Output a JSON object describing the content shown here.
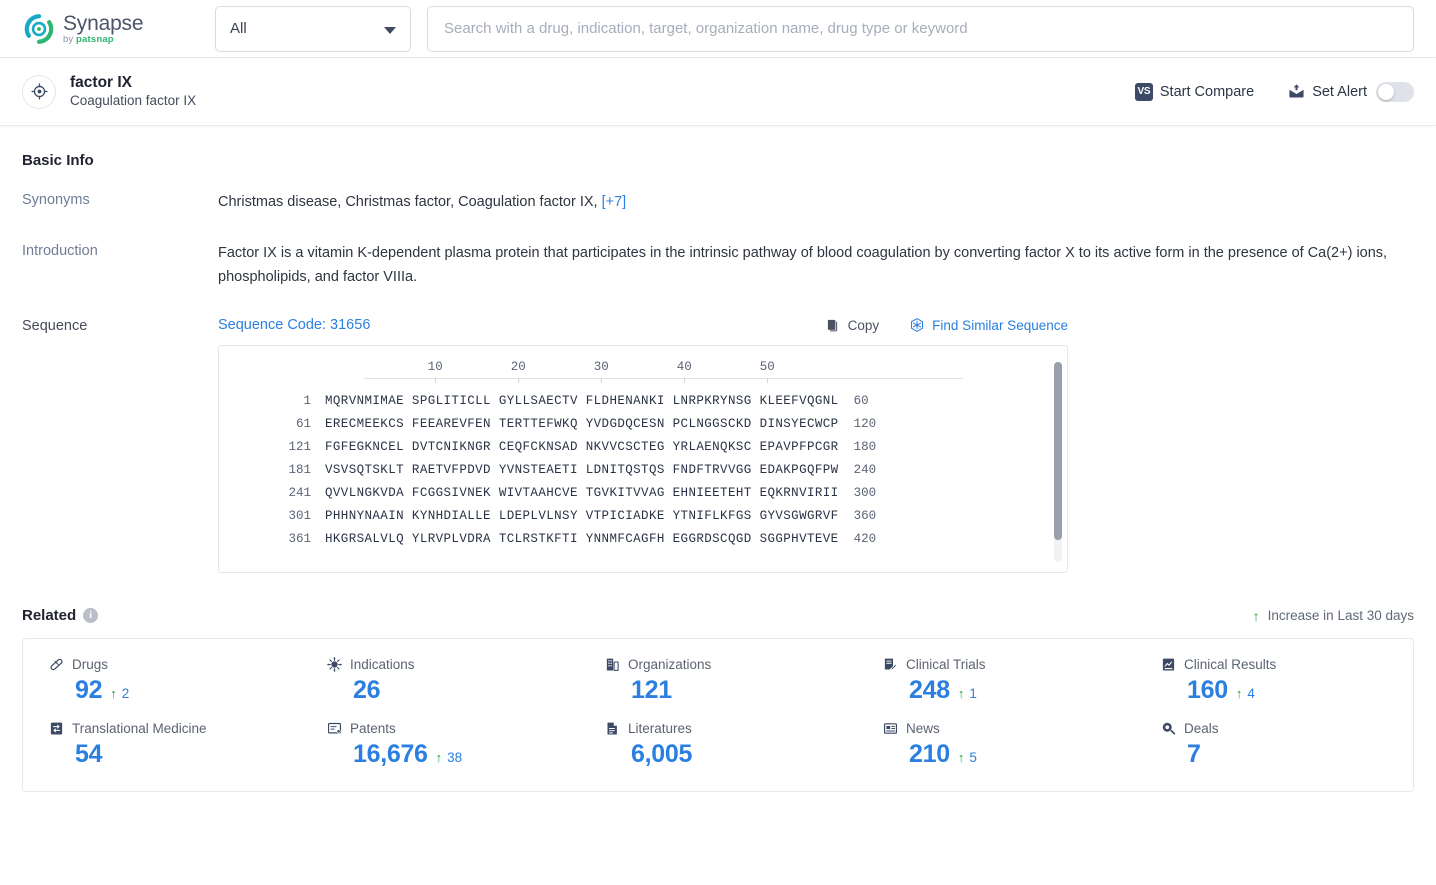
{
  "topbar": {
    "logo_name": "Synapse",
    "logo_sub_prefix": "by ",
    "logo_sub_brand": "patsnap",
    "scope_value": "All",
    "scope_options": [
      "All"
    ],
    "search_placeholder": "Search with a drug, indication, target, organization name, drug type or keyword",
    "search_value": ""
  },
  "entity": {
    "title": "factor IX",
    "subtitle": "Coagulation factor IX",
    "compare_label": "Start Compare",
    "compare_badge": "VS",
    "alert_label": "Set Alert",
    "alert_enabled": false
  },
  "basic_info": {
    "heading": "Basic Info",
    "synonyms_label": "Synonyms",
    "synonyms_value": "Christmas disease,  Christmas factor,  Coagulation factor IX,",
    "synonyms_more": "[+7]",
    "introduction_label": "Introduction",
    "introduction_value": "Factor IX is a vitamin K-dependent plasma protein that participates in the intrinsic pathway of blood coagulation by converting factor X to its active form in the presence of Ca(2+) ions, phospholipids, and factor VIIIa.",
    "sequence_label": "Sequence",
    "sequence_code": "Sequence Code: 31656",
    "copy_label": "Copy",
    "find_similar_label": "Find Similar Sequence"
  },
  "sequence": {
    "ruler_ticks": [
      10,
      20,
      30,
      40,
      50
    ],
    "rows": [
      {
        "start": "1",
        "blocks": "MQRVNMIMAE SPGLITICLL GYLLSAECTV FLDHENANKI LNRPKRYNSG KLEEFVQGNL",
        "end": "60"
      },
      {
        "start": "61",
        "blocks": "ERECMEEKCS FEEAREVFEN TERTTEFWKQ YVDGDQCESN PCLNGGSCKD DINSYECWCP",
        "end": "120"
      },
      {
        "start": "121",
        "blocks": "FGFEGKNCEL DVTCNIKNGR CEQFCKNSAD NKVVCSCTEG YRLAENQKSC EPAVPFPCGR",
        "end": "180"
      },
      {
        "start": "181",
        "blocks": "VSVSQTSKLT RAETVFPDVD YVNSTEAETI LDNITQSTQS FNDFTRVVGG EDAKPGQFPW",
        "end": "240"
      },
      {
        "start": "241",
        "blocks": "QVVLNGKVDA FCGGSIVNEK WIVTAAHCVE TGVKITVVAG EHNIEETEHT EQKRNVIRII",
        "end": "300"
      },
      {
        "start": "301",
        "blocks": "PHHNYNAAIN KYNHDIALLE LDEPLVLNSY VTPICIADKE YTNIFLKFGS GYVSGWGRVF",
        "end": "360"
      },
      {
        "start": "361",
        "blocks": "HKGRSALVLQ YLRVPLVDRA TCLRSTKFTI YNNMFCAGFH EGGRDSCQGD SGGPHVTEVE",
        "end": "420"
      }
    ]
  },
  "related": {
    "heading": "Related",
    "info_glyph": "i",
    "legend_label": "Increase in Last 30 days",
    "legend_arrow": "↑",
    "stats": [
      {
        "label": "Drugs",
        "icon": "pill-icon",
        "value": "92",
        "delta": "2"
      },
      {
        "label": "Indications",
        "icon": "virus-icon",
        "value": "26",
        "delta": ""
      },
      {
        "label": "Organizations",
        "icon": "organization-icon",
        "value": "121",
        "delta": ""
      },
      {
        "label": "Clinical Trials",
        "icon": "clinical-trial-icon",
        "value": "248",
        "delta": "1"
      },
      {
        "label": "Clinical Results",
        "icon": "clinical-result-icon",
        "value": "160",
        "delta": "4"
      },
      {
        "label": "Translational Medicine",
        "icon": "translational-medicine-icon",
        "value": "54",
        "delta": ""
      },
      {
        "label": "Patents",
        "icon": "patent-icon",
        "value": "16,676",
        "delta": "38"
      },
      {
        "label": "Literatures",
        "icon": "literature-icon",
        "value": "6,005",
        "delta": ""
      },
      {
        "label": "News",
        "icon": "news-icon",
        "value": "210",
        "delta": "5"
      },
      {
        "label": "Deals",
        "icon": "deal-icon",
        "value": "7",
        "delta": ""
      }
    ]
  },
  "colors": {
    "accent_blue": "#2a7fe0",
    "increase_green": "#21a43a",
    "logo_teal": "#18a9c9",
    "logo_green": "#2bb673",
    "badge_navy": "#3d4a66"
  }
}
